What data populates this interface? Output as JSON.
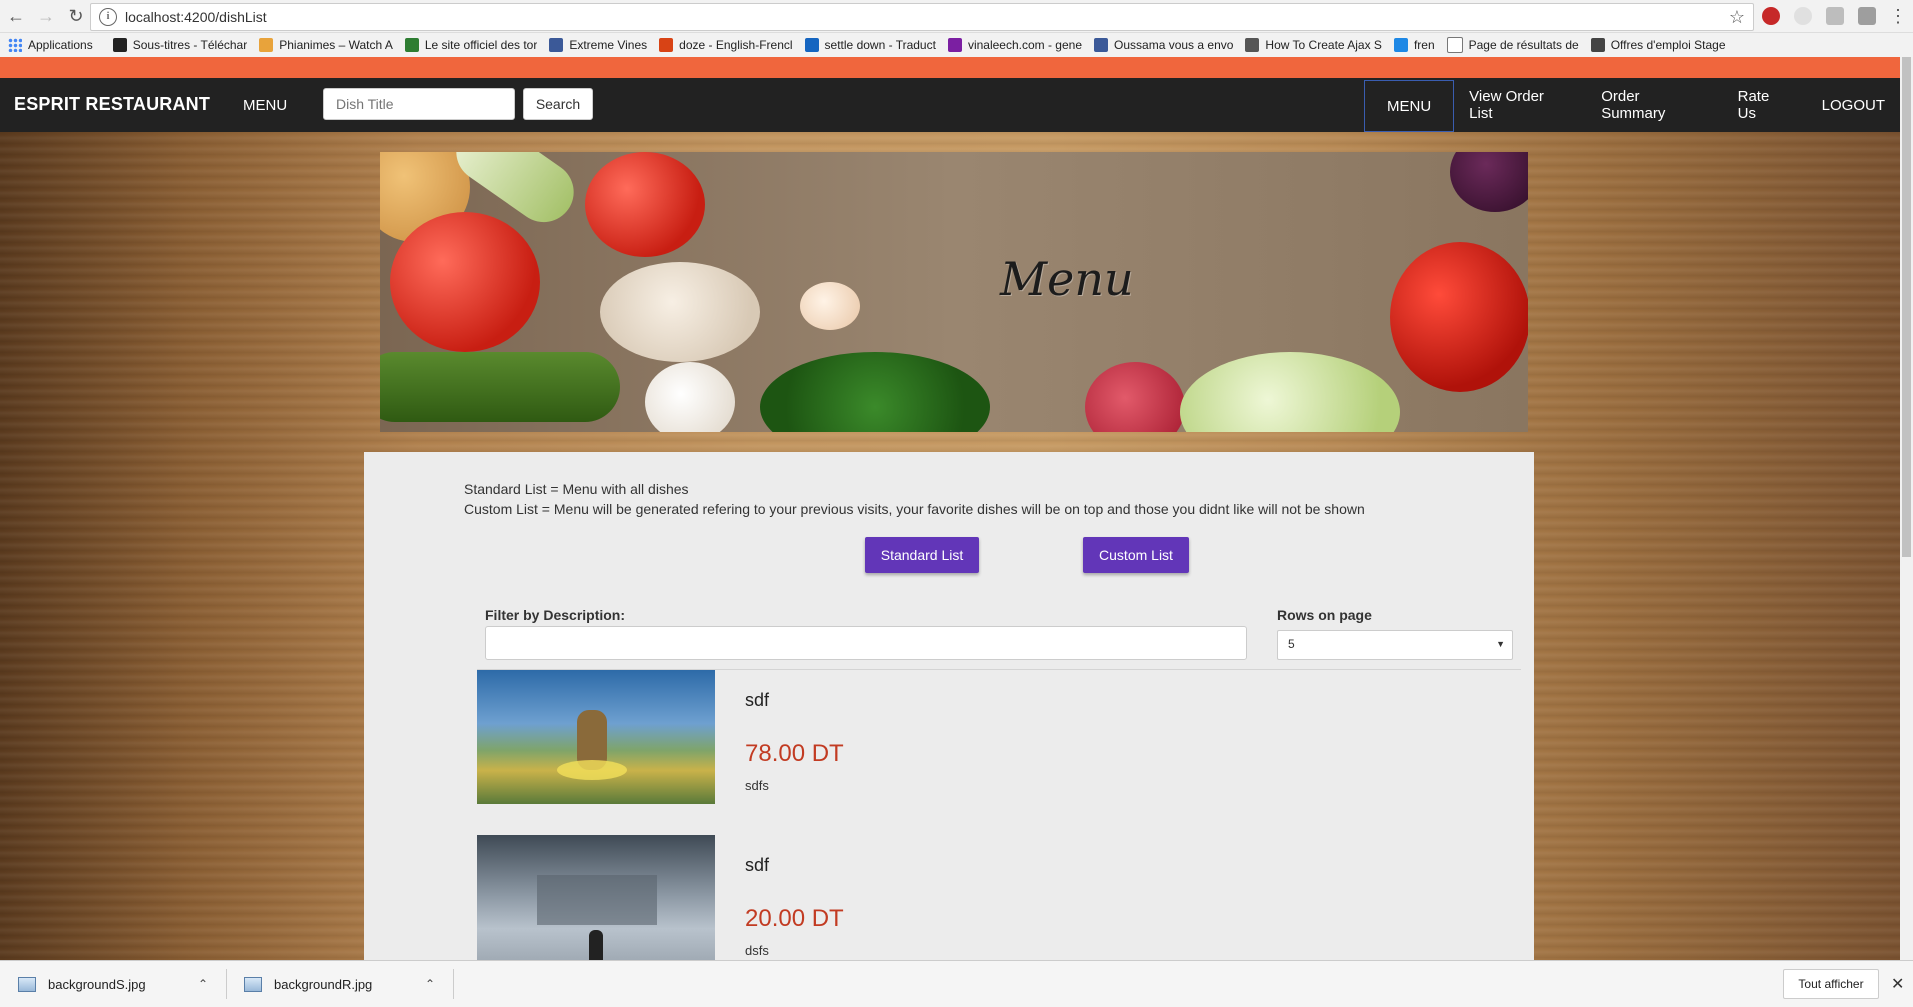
{
  "browser": {
    "url": "localhost:4200/dishList",
    "bookmarks": [
      {
        "label": "Applications",
        "color": "#4285f4"
      },
      {
        "label": "Sous-titres - Téléchar",
        "color": "#222222"
      },
      {
        "label": "Phianimes – Watch A",
        "color": "#e8a33b"
      },
      {
        "label": "Le site officiel des tor",
        "color": "#2e7d32"
      },
      {
        "label": "Extreme Vines",
        "color": "#3b5998"
      },
      {
        "label": "doze - English-Frencl",
        "color": "#d84315"
      },
      {
        "label": "settle down - Traduct",
        "color": "#1565c0"
      },
      {
        "label": "vinaleech.com - gene",
        "color": "#7b1fa2"
      },
      {
        "label": "Oussama vous a envo",
        "color": "#3b5998"
      },
      {
        "label": "How To Create Ajax S",
        "color": "#555555"
      },
      {
        "label": "fren",
        "color": "#1e88e5"
      },
      {
        "label": "Page de résultats de",
        "color": "#777777"
      },
      {
        "label": "Offres d'emploi Stage",
        "color": "#444444"
      }
    ]
  },
  "navbar": {
    "brand": "ESPRIT RESTAURANT",
    "menu_left": "MENU",
    "search_placeholder": "Dish Title",
    "search_button": "Search",
    "links": [
      "MENU",
      "View Order List",
      "Order Summary",
      "Rate Us",
      "LOGOUT"
    ]
  },
  "banner": {
    "title": "Menu"
  },
  "content": {
    "description_line1": "Standard List = Menu with all dishes",
    "description_line2": "Custom List = Menu will be generated refering to your previous visits, your favorite dishes will be on top and those you didnt like will not be shown",
    "standard_button": "Standard List",
    "custom_button": "Custom List",
    "filter_label": "Filter by Description:",
    "rows_label": "Rows on page",
    "rows_value": "5",
    "dishes": [
      {
        "name": "sdf",
        "price": "78.00 DT",
        "description": "sdfs"
      },
      {
        "name": "sdf",
        "price": "20.00 DT",
        "description": "dsfs"
      }
    ]
  },
  "downloads": {
    "items": [
      "backgroundS.jpg",
      "backgroundR.jpg"
    ],
    "show_all": "Tout afficher"
  },
  "colors": {
    "accent_orange": "#f0663d",
    "navbar_bg": "#222222",
    "button_purple": "#6236b8",
    "price_red": "#c23b22"
  }
}
